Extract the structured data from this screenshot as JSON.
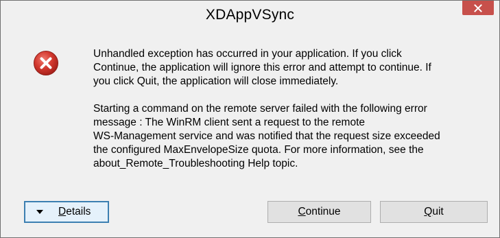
{
  "window": {
    "title": "XDAppVSync",
    "close_icon": "close-icon"
  },
  "dialog": {
    "icon": "error-icon",
    "message_1": "Unhandled exception has occurred in your application. If you click\nContinue, the application will ignore this error and attempt to continue. If\nyou click Quit, the application will close immediately.",
    "message_2": "Starting a command on the remote server failed with the following error\nmessage : The WinRM client sent a request to the remote\nWS-Management service and was notified that the request size exceeded\nthe configured MaxEnvelopeSize quota. For more information, see the\nabout_Remote_Troubleshooting Help topic."
  },
  "buttons": {
    "details_label": "Details",
    "continue_label": "Continue",
    "quit_label": "Quit"
  },
  "colors": {
    "close_button": "#c7504b",
    "error_icon": "#c8312b",
    "focus_border": "#3c7fb1"
  }
}
